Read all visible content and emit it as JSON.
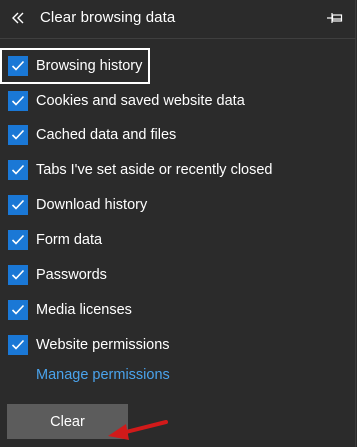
{
  "panel": {
    "title": "Clear browsing data",
    "back_icon": "double-chevron-left-icon",
    "pin_icon": "pin-icon"
  },
  "items": [
    {
      "label": "Browsing history",
      "checked": true,
      "focused": true
    },
    {
      "label": "Cookies and saved website data",
      "checked": true
    },
    {
      "label": "Cached data and files",
      "checked": true
    },
    {
      "label": "Tabs I've set aside or recently closed",
      "checked": true
    },
    {
      "label": "Download history",
      "checked": true
    },
    {
      "label": "Form data",
      "checked": true
    },
    {
      "label": "Passwords",
      "checked": true
    },
    {
      "label": "Media licenses",
      "checked": true
    },
    {
      "label": "Website permissions",
      "checked": true
    }
  ],
  "manage_link": "Manage permissions",
  "clear_button": "Clear",
  "colors": {
    "background": "#2b2b2b",
    "checkbox": "#1a78d6",
    "link": "#4aa3ec",
    "button": "#5c5c5c",
    "annotation_arrow": "#d11a1a"
  }
}
